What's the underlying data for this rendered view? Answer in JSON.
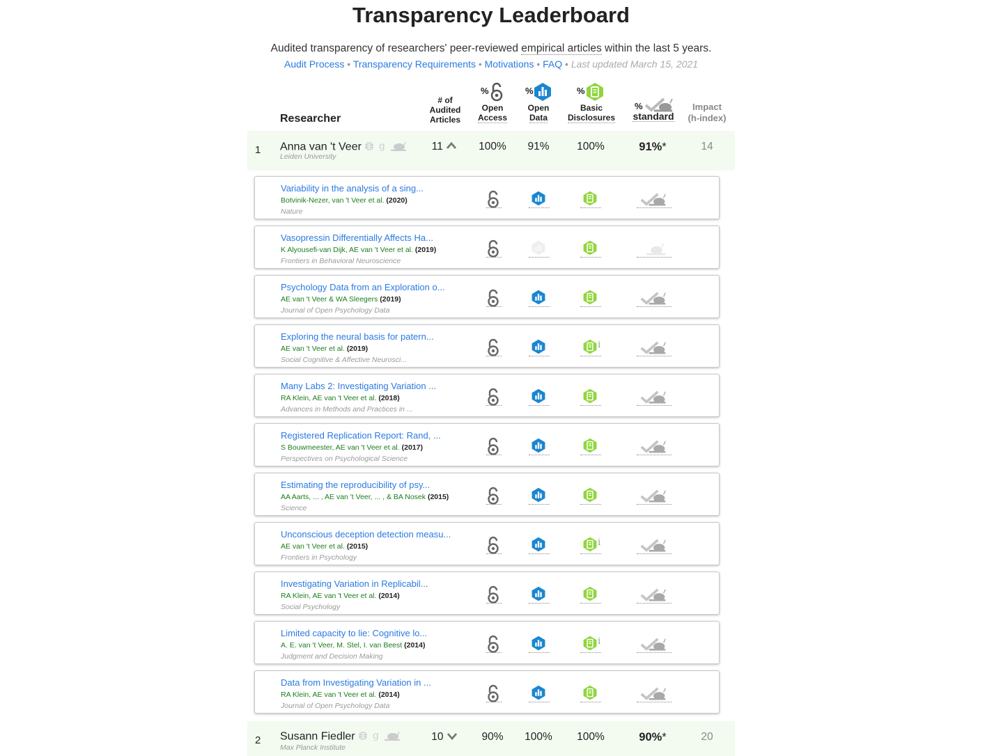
{
  "header": {
    "title": "Transparency Leaderboard",
    "subtitle_pre": "Audited transparency of researchers' peer-reviewed ",
    "subtitle_link": "empirical articles",
    "subtitle_post": " within the last 5 years.",
    "links": [
      "Audit Process",
      "Transparency Requirements",
      "Motivations",
      "FAQ"
    ],
    "separator": " • ",
    "last_updated": "Last updated March 15, 2021"
  },
  "columns": {
    "researcher": "Researcher",
    "audited_l1": "# of",
    "audited_l2": "Audited",
    "audited_l3": "Articles",
    "pct": "%",
    "oa_l1": "Open",
    "oa_l2": "Access",
    "od_l1": "Open",
    "od_l2": "Data",
    "bd_l1": "Basic",
    "bd_l2": "Disclosures",
    "std": "standard",
    "impact_l1": "Impact",
    "impact_l2": "(h-index)"
  },
  "researchers": [
    {
      "rank": "1",
      "name": "Anna van 't Veer",
      "institution": "Leiden University",
      "articles": "11",
      "open_access": "100%",
      "open_data": "91%",
      "basic_disclosures": "100%",
      "standard": "91%",
      "standard_mark": "*",
      "impact": "14",
      "expanded": true
    },
    {
      "rank": "2",
      "name": "Susann Fiedler",
      "institution": "Max Planck Institute",
      "articles": "10",
      "open_access": "90%",
      "open_data": "100%",
      "basic_disclosures": "100%",
      "standard": "90%",
      "standard_mark": "*",
      "impact": "20",
      "expanded": false
    }
  ],
  "articles": [
    {
      "title": "Variability in the analysis of a sing...",
      "authors": "Botvinik-Nezer, van 't Veer et al.",
      "year": "(2020)",
      "journal": "Nature",
      "open_data": true,
      "bd_info": false,
      "standard": true
    },
    {
      "title": "Vasopressin Differentially Affects Ha...",
      "authors": "K Alyousefi-van Dijk, AE van 't Veer et al.",
      "year": "(2019)",
      "journal": "Frontiers in Behavioral Neuroscience",
      "open_data": false,
      "bd_info": false,
      "standard": false
    },
    {
      "title": "Psychology Data from an Exploration o...",
      "authors": "AE van 't Veer & WA Sleegers",
      "year": "(2019)",
      "journal": "Journal of Open Psychology Data",
      "open_data": true,
      "bd_info": false,
      "standard": true
    },
    {
      "title": "Exploring the neural basis for patern...",
      "authors": "AE van 't Veer et al.",
      "year": "(2019)",
      "journal": "Social Cognitive & Affective Neurosci...",
      "open_data": true,
      "bd_info": true,
      "standard": true
    },
    {
      "title": "Many Labs 2: Investigating Variation ...",
      "authors": "RA Klein, AE van 't Veer et al.",
      "year": "(2018)",
      "journal": "Advances in Methods and Practices in ...",
      "open_data": true,
      "bd_info": false,
      "standard": true
    },
    {
      "title": "Registered Replication Report: Rand, ...",
      "authors": "S Bouwmeester, AE van 't Veer et al.",
      "year": "(2017)",
      "journal": "Perspectives on Psychological Science",
      "open_data": true,
      "bd_info": false,
      "standard": true
    },
    {
      "title": "Estimating the reproducibility of psy...",
      "authors": "AA Aarts, ... , AE van 't Veer, ... , & BA Nosek",
      "year": "(2015)",
      "journal": "Science",
      "open_data": true,
      "bd_info": false,
      "standard": true
    },
    {
      "title": "Unconscious deception detection measu...",
      "authors": "AE van 't Veer et al.",
      "year": "(2015)",
      "journal": "Frontiers in Psychology",
      "open_data": true,
      "bd_info": true,
      "standard": true
    },
    {
      "title": "Investigating Variation in Replicabil...",
      "authors": "RA Klein, AE van 't Veer et al.",
      "year": "(2014)",
      "journal": "Social Psychology",
      "open_data": true,
      "bd_info": false,
      "standard": true
    },
    {
      "title": "Limited capacity to lie: Cognitive lo...",
      "authors": "A. E. van 't Veer, M. Stel, I. van Beest",
      "year": "(2014)",
      "journal": "Judgment and Decision Making",
      "open_data": true,
      "bd_info": true,
      "standard": true
    },
    {
      "title": "Data from Investigating Variation in ...",
      "authors": "RA Klein, AE van 't Veer et al.",
      "year": "(2014)",
      "journal": "Journal of Open Psychology Data",
      "open_data": true,
      "bd_info": false,
      "standard": true
    }
  ],
  "colors": {
    "link": "#2a7ae2",
    "open_data_blue": "#1a86d0",
    "disclosure_green": "#8fd63a",
    "row_highlight": "#f3fbf1",
    "author_green": "#1b7d1b"
  },
  "icons": [
    "open-access-lock-icon",
    "open-data-chart-icon",
    "basic-disclosures-badge-icon",
    "standard-checkmark-snail-icon",
    "globe-icon",
    "google-scholar-icon",
    "snail-icon",
    "chevron-up-icon",
    "chevron-down-icon",
    "info-icon"
  ]
}
